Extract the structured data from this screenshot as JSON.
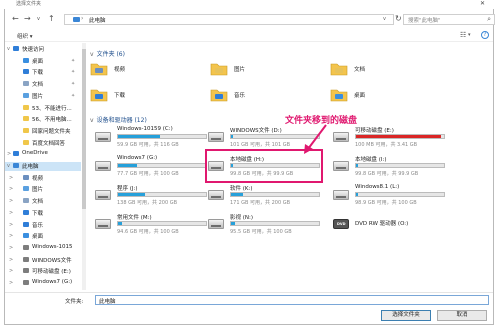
{
  "titlebar": {
    "caption": "选择文件夹"
  },
  "address": {
    "path_sep": "›",
    "location": "此电脑",
    "dropdown": "v"
  },
  "search": {
    "placeholder": "搜索\"此电脑\""
  },
  "toolbar": {
    "organize": "组织 ▾"
  },
  "sidebar": {
    "items": [
      {
        "label": "快速访问",
        "level": 0,
        "color": "#2f7ed8",
        "chev": "v",
        "pin": false
      },
      {
        "label": "桌面",
        "level": 1,
        "color": "#3a8fe0",
        "pin": true
      },
      {
        "label": "下载",
        "level": 1,
        "color": "#2f7ed8",
        "pin": true
      },
      {
        "label": "文档",
        "level": 1,
        "color": "#8aa4c4",
        "pin": true
      },
      {
        "label": "图片",
        "level": 1,
        "color": "#5aa0e0",
        "pin": true
      },
      {
        "label": "53、不能进行...",
        "level": 1,
        "color": "#f0c74a",
        "pin": false
      },
      {
        "label": "56、不用电脑...",
        "level": 1,
        "color": "#f0c74a",
        "pin": false
      },
      {
        "label": "回家问题文件夹",
        "level": 1,
        "color": "#f0c74a",
        "pin": false
      },
      {
        "label": "百度文档回答",
        "level": 1,
        "color": "#f0c74a",
        "pin": false
      },
      {
        "label": "OneDrive",
        "level": 0,
        "color": "#2f7ed8",
        "chev": ">",
        "pin": false
      },
      {
        "label": "此电脑",
        "level": 0,
        "color": "#3a86d6",
        "chev": "v",
        "pin": false,
        "selected": true
      },
      {
        "label": "视频",
        "level": 1,
        "color": "#6b8fbf",
        "chev": ">",
        "pin": false
      },
      {
        "label": "图片",
        "level": 1,
        "color": "#5aa0e0",
        "chev": ">",
        "pin": false
      },
      {
        "label": "文档",
        "level": 1,
        "color": "#8aa4c4",
        "chev": ">",
        "pin": false
      },
      {
        "label": "下载",
        "level": 1,
        "color": "#2f7ed8",
        "chev": ">",
        "pin": false
      },
      {
        "label": "音乐",
        "level": 1,
        "color": "#2f7ed8",
        "chev": ">",
        "pin": false
      },
      {
        "label": "桌面",
        "level": 1,
        "color": "#3a8fe0",
        "chev": ">",
        "pin": false
      },
      {
        "label": "Windows-1015",
        "level": 1,
        "color": "#7d7d7d",
        "chev": ">",
        "pin": false
      },
      {
        "label": "WINDOWS文件",
        "level": 1,
        "color": "#7d7d7d",
        "chev": ">",
        "pin": false
      },
      {
        "label": "可移动磁盘 (E:)",
        "level": 1,
        "color": "#7d7d7d",
        "chev": ">",
        "pin": false
      },
      {
        "label": "Windows7 (G:)",
        "level": 1,
        "color": "#7d7d7d",
        "chev": ">",
        "pin": false
      }
    ]
  },
  "sections": {
    "folders": "文件夹 (6)",
    "drives": "设备和驱动器 (12)"
  },
  "folders": [
    {
      "label": "视频",
      "color": "#6b8fbf"
    },
    {
      "label": "图片",
      "color": "#e7c25a"
    },
    {
      "label": "文档",
      "color": "#e7c25a"
    },
    {
      "label": "下载",
      "color": "#2f7ed8"
    },
    {
      "label": "音乐",
      "color": "#2f7ed8"
    },
    {
      "label": "桌面",
      "color": "#3a8fe0"
    }
  ],
  "drives": [
    {
      "name": "Windows-10159 (C:)",
      "info": "59.9 GB 可用，共 116 GB",
      "used": 0.48,
      "warn": false
    },
    {
      "name": "WINDOWS文件 (D:)",
      "info": "101 GB 可用，共 101 GB",
      "used": 0.0,
      "warn": false
    },
    {
      "name": "可移动磁盘 (E:)",
      "info": "100 MB 可用，共 3.41 GB",
      "used": 0.97,
      "warn": true
    },
    {
      "name": "Windows7 (G:)",
      "info": "77.7 GB 可用，共 100 GB",
      "used": 0.22,
      "warn": false
    },
    {
      "name": "本地磁盘 (H:)",
      "info": "99.8 GB 可用，共 99.9 GB",
      "used": 0.0,
      "warn": false
    },
    {
      "name": "本地磁盘 (I:)",
      "info": "99.8 GB 可用，共 99.9 GB",
      "used": 0.0,
      "warn": false
    },
    {
      "name": "程序 (J:)",
      "info": "138 GB 可用，共 200 GB",
      "used": 0.31,
      "warn": false
    },
    {
      "name": "软件 (K:)",
      "info": "171 GB 可用，共 200 GB",
      "used": 0.14,
      "warn": false
    },
    {
      "name": "Windows8.1 (L:)",
      "info": "98.9 GB 可用，共 100 GB",
      "used": 0.01,
      "warn": false
    },
    {
      "name": "常用文件 (M:)",
      "info": "94.6 GB 可用，共 100 GB",
      "used": 0.05,
      "warn": false
    },
    {
      "name": "影视 (N:)",
      "info": "95.5 GB 可用，共 100 GB",
      "used": 0.05,
      "warn": false
    },
    {
      "name": "DVD RW 驱动器 (O:)",
      "info": "",
      "used": null,
      "warn": false,
      "dvd": true
    }
  ],
  "dvd_label": "DVD",
  "annotation": "文件夹移到的磁盘",
  "footer": {
    "folder_label": "文件夹:",
    "folder_value": "此电脑",
    "select_btn": "选择文件夹",
    "cancel_btn": "取消"
  },
  "icons": {
    "back": "←",
    "forward": "→",
    "up": "↑",
    "refresh": "↻",
    "search": "⌕",
    "view": "☷",
    "view_drop": "▾",
    "help": "?"
  }
}
